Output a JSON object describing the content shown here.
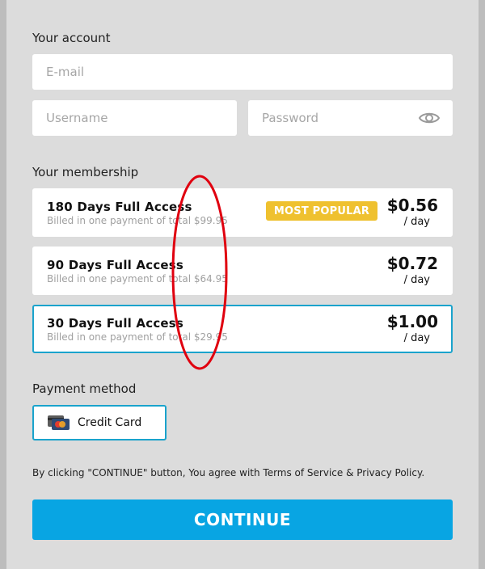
{
  "account": {
    "title": "Your account",
    "email_placeholder": "E-mail",
    "username_placeholder": "Username",
    "password_placeholder": "Password",
    "password_toggle_icon": "eye-icon"
  },
  "membership": {
    "title": "Your membership",
    "plans": [
      {
        "name": "180 Days Full Access",
        "billing": "Billed in one payment of total $99.95",
        "price": "$0.56",
        "per": "/ day",
        "badge": "MOST POPULAR",
        "selected": false
      },
      {
        "name": "90 Days Full Access",
        "billing": "Billed in one payment of total $64.95",
        "price": "$0.72",
        "per": "/ day",
        "selected": false
      },
      {
        "name": "30 Days Full Access",
        "billing": "Billed in one payment of total $29.95",
        "price": "$1.00",
        "per": "/ day",
        "selected": true
      }
    ]
  },
  "payment": {
    "title": "Payment method",
    "method_label": "Credit Card",
    "method_icon": "credit-card-icon"
  },
  "terms": "By clicking \"CONTINUE\" button, You agree with Terms of Service & Privacy Policy.",
  "continue_label": "CONTINUE",
  "colors": {
    "accent": "#08a5e3",
    "selected_border": "#1aa3cc",
    "badge": "#efc12f",
    "panel_bg": "#dcdcdc",
    "annotation": "#e0000f"
  }
}
